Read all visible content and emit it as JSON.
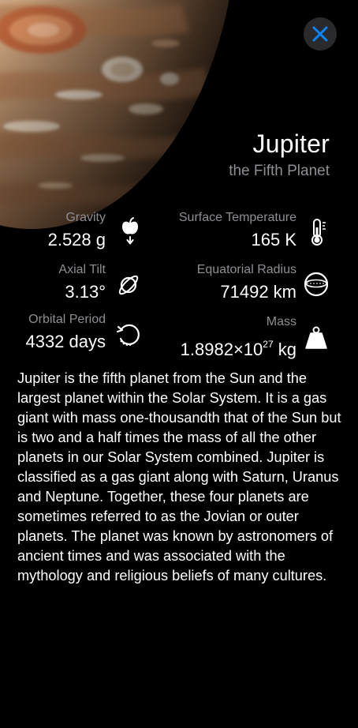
{
  "planet": {
    "name": "Jupiter",
    "subtitle": "the Fifth Planet"
  },
  "close_icon": "close-icon",
  "stats": {
    "gravity": {
      "label": "Gravity",
      "value": "2.528 g",
      "icon": "apple-falling-icon"
    },
    "surface_temperature": {
      "label": "Surface Temperature",
      "value": "165 K",
      "icon": "thermometer-icon"
    },
    "axial_tilt": {
      "label": "Axial Tilt",
      "value": "3.13°",
      "icon": "tilted-planet-icon"
    },
    "equatorial_radius": {
      "label": "Equatorial Radius",
      "value": "71492 km",
      "icon": "sphere-equator-icon"
    },
    "orbital_period": {
      "label": "Orbital Period",
      "value": "4332 days",
      "icon": "orbit-arrow-icon"
    },
    "mass": {
      "label": "Mass",
      "value_base": "1.8982×10",
      "value_exp": "27",
      "value_unit": " kg",
      "icon": "weight-icon"
    }
  },
  "description": "Jupiter is the fifth planet from the Sun and the largest planet within the Solar System. It is a gas giant with mass one-thousandth that of the Sun but is two and a half times the mass of all the other planets in our Solar System combined. Jupiter is classified as a gas giant along with Saturn, Uranus and Neptune. Together, these four planets are sometimes referred to as the Jovian or outer planets. The planet was known by astronomers of ancient times and was associated with the mythology and religious beliefs of many cultures.",
  "colors": {
    "background": "#000000",
    "secondary_text": "#8e8e93",
    "close_accent": "#0a84ff"
  }
}
